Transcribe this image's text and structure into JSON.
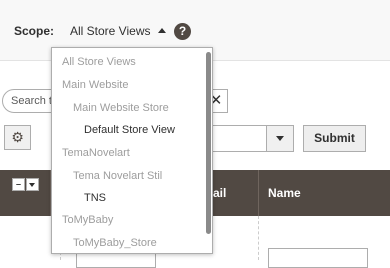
{
  "scope": {
    "label": "Scope:",
    "current": "All Store Views",
    "help": "?",
    "options": [
      {
        "label": "All Store Views",
        "level": 0,
        "enabled": false
      },
      {
        "label": "Main Website",
        "level": 0,
        "enabled": false
      },
      {
        "label": "Main Website Store",
        "level": 1,
        "enabled": false
      },
      {
        "label": "Default Store View",
        "level": 2,
        "enabled": true
      },
      {
        "label": "TemaNovelart",
        "level": 0,
        "enabled": false
      },
      {
        "label": "Tema Novelart Stil",
        "level": 1,
        "enabled": false
      },
      {
        "label": "TNS",
        "level": 2,
        "enabled": true
      },
      {
        "label": "ToMyBaby",
        "level": 0,
        "enabled": false
      },
      {
        "label": "ToMyBaby_Store",
        "level": 1,
        "enabled": false
      }
    ]
  },
  "toolbar": {
    "search_placeholder": "Search to",
    "clear_symbol": "✕",
    "gear_symbol": "⚙",
    "submit_label": "Submit"
  },
  "grid": {
    "columns": [
      "ail",
      "Name"
    ]
  },
  "colors": {
    "header_bg": "#514943",
    "disabled_text": "#9d9d9d"
  }
}
